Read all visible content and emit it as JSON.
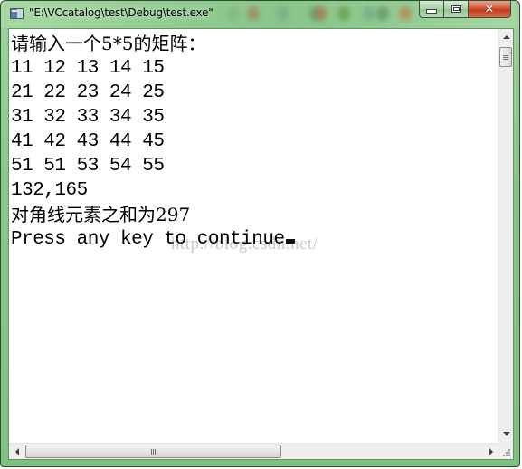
{
  "window": {
    "title": "\"E:\\VCcatalog\\test\\Debug\\test.exe\"",
    "app_icon": "console-app-icon",
    "buttons": {
      "minimize": "minimize-icon",
      "maximize": "maximize-icon",
      "close": "close-icon",
      "close_glyph": "✕"
    }
  },
  "console": {
    "lines": [
      "请输入一个5*5的矩阵：",
      "11 12 13 14 15",
      "21 22 23 24 25",
      "31 32 33 34 35",
      "41 42 43 44 45",
      "51 51 53 54 55",
      "132,165",
      "对角线元素之和为297",
      "Press any key to continue"
    ],
    "watermark": "http://blog.csdn.net/",
    "cursor": "block-cursor"
  },
  "scrollbars": {
    "vertical": {
      "position": 0.0,
      "visible_fraction": 0.05
    },
    "horizontal": {
      "position": 0.0,
      "visible_fraction": 0.56
    }
  }
}
